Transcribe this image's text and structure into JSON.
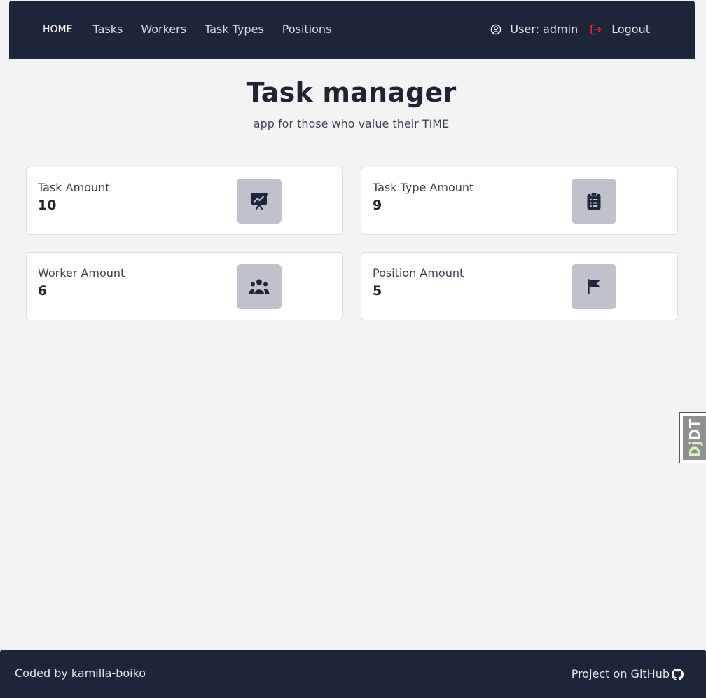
{
  "nav": {
    "links": [
      {
        "label": "HOME"
      },
      {
        "label": "Tasks"
      },
      {
        "label": "Workers"
      },
      {
        "label": "Task Types"
      },
      {
        "label": "Positions"
      }
    ],
    "user_label": "User: admin",
    "logout_label": "Logout"
  },
  "hero": {
    "title": "Task manager",
    "subtitle": "app for those who value their TIME"
  },
  "cards": [
    {
      "label": "Task Amount",
      "value": "10",
      "icon": "presentation-chart-icon"
    },
    {
      "label": "Task Type Amount",
      "value": "9",
      "icon": "clipboard-list-icon"
    },
    {
      "label": "Worker Amount",
      "value": "6",
      "icon": "users-group-icon"
    },
    {
      "label": "Position Amount",
      "value": "5",
      "icon": "flag-icon"
    }
  ],
  "debug_toolbar": {
    "prefix": "Dj",
    "suffix": "DT"
  },
  "footer": {
    "credit": "Coded by kamilla-boiko",
    "github_label": "Project on GitHub"
  },
  "colors": {
    "navbar": "#1f2538",
    "background": "#f2f3f5",
    "card_icon_bg": "#bfc2ca",
    "logout_icon": "#e0243a"
  }
}
